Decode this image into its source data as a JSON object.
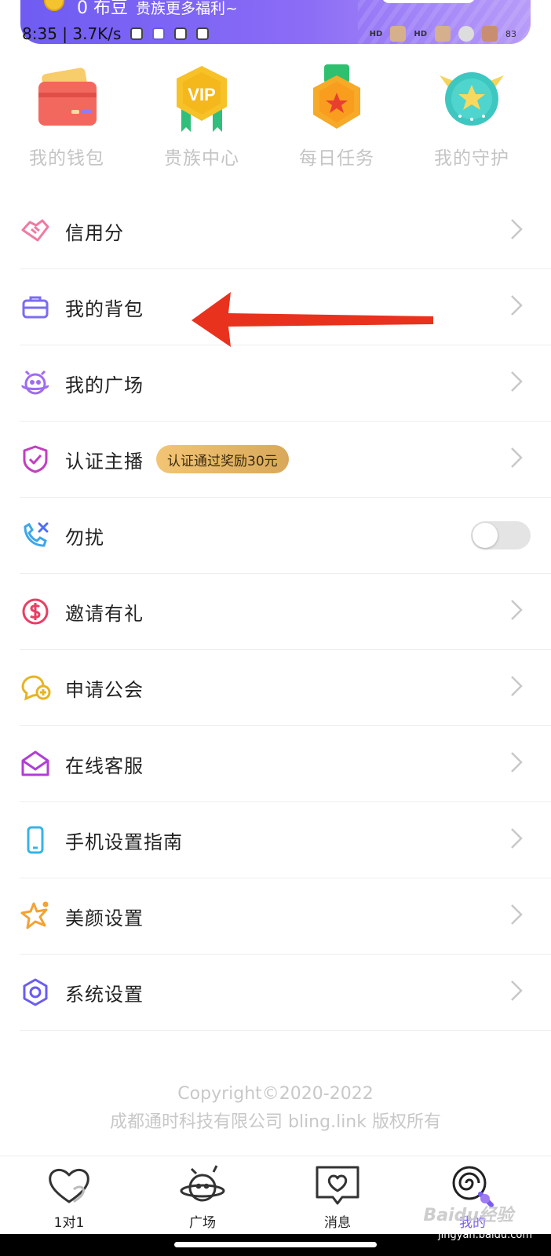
{
  "banner": {
    "coins": "0 布豆",
    "promo": "贵族更多福利~"
  },
  "status_bar": {
    "time": "8:35",
    "speed": "3.7K/s",
    "hd1": "HD",
    "hd2": "HD",
    "battery": "83"
  },
  "quick_entries": [
    {
      "label": "我的钱包",
      "icon": "wallet-icon"
    },
    {
      "label": "贵族中心",
      "icon": "vip-medal-icon"
    },
    {
      "label": "每日任务",
      "icon": "task-medal-icon"
    },
    {
      "label": "我的守护",
      "icon": "guard-badge-icon"
    }
  ],
  "vip_text": "VIP",
  "menu": [
    {
      "label": "信用分",
      "icon": "handshake-icon"
    },
    {
      "label": "我的背包",
      "icon": "briefcase-icon"
    },
    {
      "label": "我的广场",
      "icon": "planet-face-icon"
    },
    {
      "label": "认证主播",
      "icon": "shield-check-icon",
      "badge": "认证通过奖励30元"
    },
    {
      "label": "勿扰",
      "icon": "phone-block-icon",
      "toggle": false
    },
    {
      "label": "邀请有礼",
      "icon": "dollar-circle-icon"
    },
    {
      "label": "申请公会",
      "icon": "chat-plus-icon"
    },
    {
      "label": "在线客服",
      "icon": "mail-open-icon"
    },
    {
      "label": "手机设置指南",
      "icon": "phone-icon"
    },
    {
      "label": "美颜设置",
      "icon": "sparkle-icon"
    },
    {
      "label": "系统设置",
      "icon": "settings-hex-icon"
    }
  ],
  "copyright": {
    "line1": "Copyright©2020-2022",
    "line2": "成都通时科技有限公司 bling.link 版权所有"
  },
  "tabs": [
    {
      "label": "1对1",
      "icon": "heart-icon"
    },
    {
      "label": "广场",
      "icon": "planet-icon"
    },
    {
      "label": "消息",
      "icon": "message-heart-icon"
    },
    {
      "label": "我的",
      "icon": "lollipop-icon",
      "active": true
    }
  ],
  "watermark": {
    "brand": "Baidu经验",
    "url": "jingyan.baidu.com"
  },
  "colors": {
    "accent": "#7b5cf0",
    "arrow": "#e8321e",
    "badge": "#e8b867"
  }
}
